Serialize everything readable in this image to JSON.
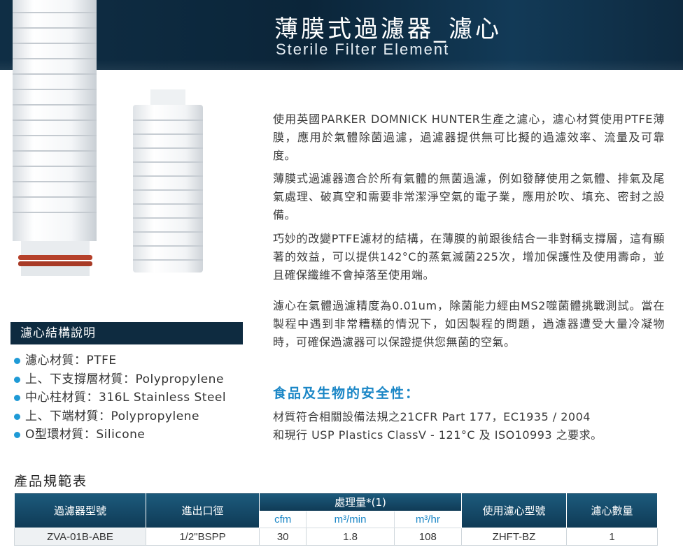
{
  "header": {
    "title_cn": "薄膜式過濾器_濾心",
    "title_en": "Sterile Filter Element"
  },
  "intro": {
    "p1": "使用英國PARKER DOMNICK HUNTER生產之濾心，濾心材質使用PTFE薄膜，應用於氣體除菌過濾，過濾器提供無可比擬的過濾效率、流量及可靠度。",
    "p2": "薄膜式過濾器適合於所有氣體的無菌過濾，例如發酵使用之氣體、排氣及尾氣處理、破真空和需要非常潔淨空氣的電子業，應用於吹、填充、密封之設備。",
    "p3": "巧妙的改變PTFE濾材的結構，在薄膜的前跟後結合一非對稱支撐層，這有顯著的效益，可以提供142°C的蒸氣滅菌225次，增加保護性及使用壽命，並且確保纖維不會掉落至使用端。",
    "p4": "濾心在氣體過濾精度為0.01um，除菌能力經由MS2噬菌體挑戰測試。當在製程中遇到非常糟糕的情況下，如因製程的問題，過濾器遭受大量冷凝物時，可確保過濾器可以保證提供您無菌的空氣。"
  },
  "structure": {
    "heading": "濾心結構說明",
    "items": [
      "濾心材質：PTFE",
      "上、下支撐層材質：Polypropylene",
      "中心柱材質：316L Stainless Steel",
      "上、下端材質：Polypropylene",
      "O型環材質：Silicone"
    ]
  },
  "safety": {
    "title": "食品及生物的安全性：",
    "line1": "材質符合相關設備法規之21CFR Part 177，EC1935 / 2004",
    "line2": "和現行 USP Plastics ClassV - 121°C 及 ISO10993 之要求。"
  },
  "spec_table": {
    "title": "產品規範表",
    "headers": {
      "model": "過濾器型號",
      "port": "進出口徑",
      "flow": "處理量*(1)",
      "element": "使用濾心型號",
      "qty": "濾心數量"
    },
    "flow_units": [
      "cfm",
      "m³/min",
      "m³/hr"
    ],
    "rows": [
      [
        "ZVA-01B-ABE",
        "1/2\"BSPP",
        "30",
        "1.8",
        "108",
        "ZHFT-BZ",
        "1"
      ]
    ]
  },
  "colors": {
    "header_bg": "#0f2e45",
    "accent_blue": "#1a86c6",
    "bullet": "#1e9ad6",
    "oring": "#b5402a"
  }
}
